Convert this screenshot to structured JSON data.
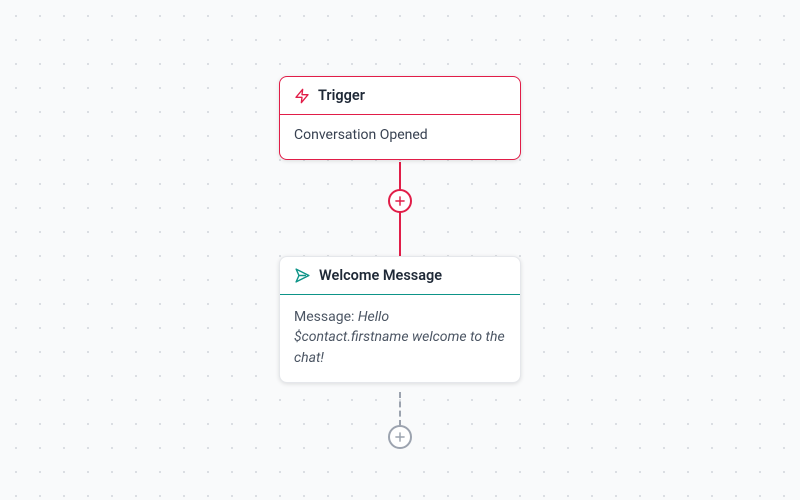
{
  "nodes": {
    "trigger": {
      "title": "Trigger",
      "body": "Conversation Opened"
    },
    "welcome": {
      "title": "Welcome Message",
      "message_label": "Message: ",
      "message_value": "Hello $contact.firstname welcome to the chat!"
    }
  },
  "colors": {
    "trigger": "#e11d48",
    "action": "#0d9488",
    "muted": "#9ca3af"
  }
}
